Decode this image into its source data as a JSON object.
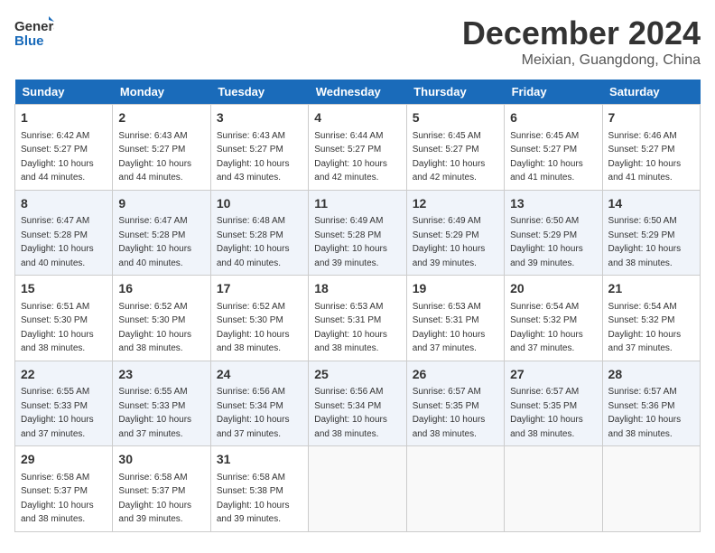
{
  "header": {
    "logo_line1": "General",
    "logo_line2": "Blue",
    "month": "December 2024",
    "location": "Meixian, Guangdong, China"
  },
  "weekdays": [
    "Sunday",
    "Monday",
    "Tuesday",
    "Wednesday",
    "Thursday",
    "Friday",
    "Saturday"
  ],
  "weeks": [
    [
      {
        "day": "1",
        "sunrise": "6:42 AM",
        "sunset": "5:27 PM",
        "daylight": "10 hours and 44 minutes."
      },
      {
        "day": "2",
        "sunrise": "6:43 AM",
        "sunset": "5:27 PM",
        "daylight": "10 hours and 44 minutes."
      },
      {
        "day": "3",
        "sunrise": "6:43 AM",
        "sunset": "5:27 PM",
        "daylight": "10 hours and 43 minutes."
      },
      {
        "day": "4",
        "sunrise": "6:44 AM",
        "sunset": "5:27 PM",
        "daylight": "10 hours and 42 minutes."
      },
      {
        "day": "5",
        "sunrise": "6:45 AM",
        "sunset": "5:27 PM",
        "daylight": "10 hours and 42 minutes."
      },
      {
        "day": "6",
        "sunrise": "6:45 AM",
        "sunset": "5:27 PM",
        "daylight": "10 hours and 41 minutes."
      },
      {
        "day": "7",
        "sunrise": "6:46 AM",
        "sunset": "5:27 PM",
        "daylight": "10 hours and 41 minutes."
      }
    ],
    [
      {
        "day": "8",
        "sunrise": "6:47 AM",
        "sunset": "5:28 PM",
        "daylight": "10 hours and 40 minutes."
      },
      {
        "day": "9",
        "sunrise": "6:47 AM",
        "sunset": "5:28 PM",
        "daylight": "10 hours and 40 minutes."
      },
      {
        "day": "10",
        "sunrise": "6:48 AM",
        "sunset": "5:28 PM",
        "daylight": "10 hours and 40 minutes."
      },
      {
        "day": "11",
        "sunrise": "6:49 AM",
        "sunset": "5:28 PM",
        "daylight": "10 hours and 39 minutes."
      },
      {
        "day": "12",
        "sunrise": "6:49 AM",
        "sunset": "5:29 PM",
        "daylight": "10 hours and 39 minutes."
      },
      {
        "day": "13",
        "sunrise": "6:50 AM",
        "sunset": "5:29 PM",
        "daylight": "10 hours and 39 minutes."
      },
      {
        "day": "14",
        "sunrise": "6:50 AM",
        "sunset": "5:29 PM",
        "daylight": "10 hours and 38 minutes."
      }
    ],
    [
      {
        "day": "15",
        "sunrise": "6:51 AM",
        "sunset": "5:30 PM",
        "daylight": "10 hours and 38 minutes."
      },
      {
        "day": "16",
        "sunrise": "6:52 AM",
        "sunset": "5:30 PM",
        "daylight": "10 hours and 38 minutes."
      },
      {
        "day": "17",
        "sunrise": "6:52 AM",
        "sunset": "5:30 PM",
        "daylight": "10 hours and 38 minutes."
      },
      {
        "day": "18",
        "sunrise": "6:53 AM",
        "sunset": "5:31 PM",
        "daylight": "10 hours and 38 minutes."
      },
      {
        "day": "19",
        "sunrise": "6:53 AM",
        "sunset": "5:31 PM",
        "daylight": "10 hours and 37 minutes."
      },
      {
        "day": "20",
        "sunrise": "6:54 AM",
        "sunset": "5:32 PM",
        "daylight": "10 hours and 37 minutes."
      },
      {
        "day": "21",
        "sunrise": "6:54 AM",
        "sunset": "5:32 PM",
        "daylight": "10 hours and 37 minutes."
      }
    ],
    [
      {
        "day": "22",
        "sunrise": "6:55 AM",
        "sunset": "5:33 PM",
        "daylight": "10 hours and 37 minutes."
      },
      {
        "day": "23",
        "sunrise": "6:55 AM",
        "sunset": "5:33 PM",
        "daylight": "10 hours and 37 minutes."
      },
      {
        "day": "24",
        "sunrise": "6:56 AM",
        "sunset": "5:34 PM",
        "daylight": "10 hours and 37 minutes."
      },
      {
        "day": "25",
        "sunrise": "6:56 AM",
        "sunset": "5:34 PM",
        "daylight": "10 hours and 38 minutes."
      },
      {
        "day": "26",
        "sunrise": "6:57 AM",
        "sunset": "5:35 PM",
        "daylight": "10 hours and 38 minutes."
      },
      {
        "day": "27",
        "sunrise": "6:57 AM",
        "sunset": "5:35 PM",
        "daylight": "10 hours and 38 minutes."
      },
      {
        "day": "28",
        "sunrise": "6:57 AM",
        "sunset": "5:36 PM",
        "daylight": "10 hours and 38 minutes."
      }
    ],
    [
      {
        "day": "29",
        "sunrise": "6:58 AM",
        "sunset": "5:37 PM",
        "daylight": "10 hours and 38 minutes."
      },
      {
        "day": "30",
        "sunrise": "6:58 AM",
        "sunset": "5:37 PM",
        "daylight": "10 hours and 39 minutes."
      },
      {
        "day": "31",
        "sunrise": "6:58 AM",
        "sunset": "5:38 PM",
        "daylight": "10 hours and 39 minutes."
      },
      null,
      null,
      null,
      null
    ]
  ]
}
